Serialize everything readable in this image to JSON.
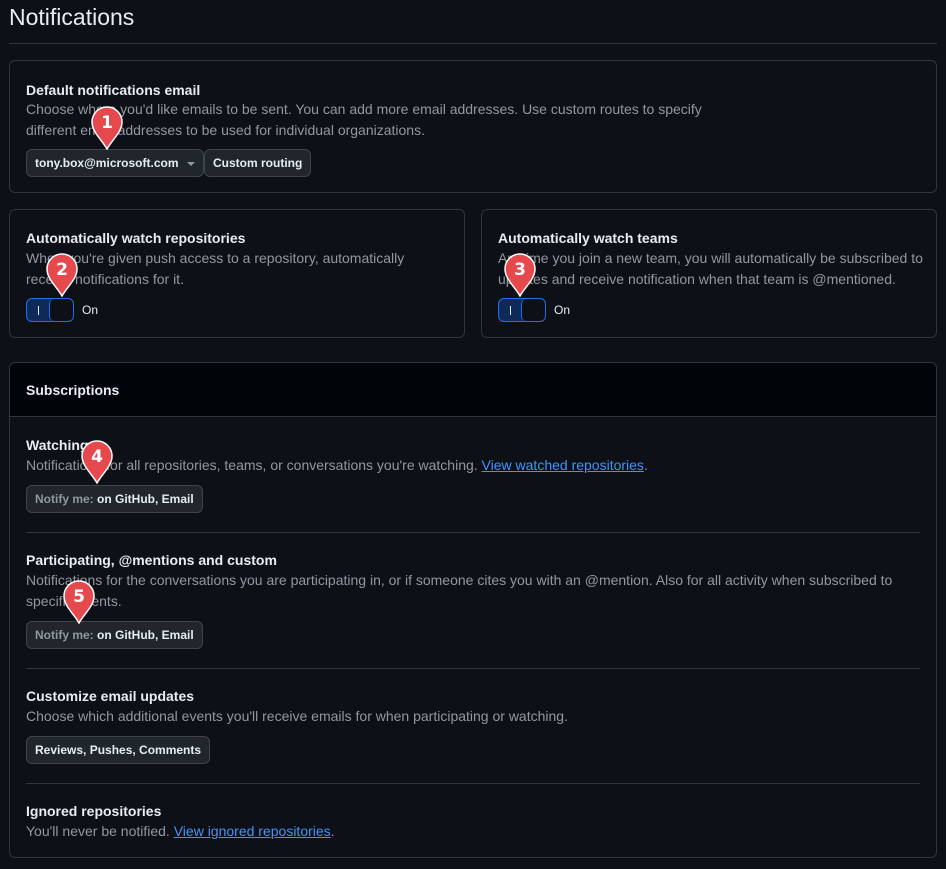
{
  "page": {
    "title": "Notifications"
  },
  "default_email": {
    "heading": "Default notifications email",
    "description": "Choose where you'd like emails to be sent. You can add more email addresses. Use custom routes to specify different email addresses to be used for individual organizations.",
    "email_select": "tony.box@microsoft.com",
    "custom_routing": "Custom routing"
  },
  "watch_repos": {
    "heading": "Automatically watch repositories",
    "description": "When you're given push access to a repository, automatically receive notifications for it.",
    "toggle_state": "On"
  },
  "watch_teams": {
    "heading": "Automatically watch teams",
    "description": "Anytime you join a new team, you will automatically be subscribed to updates and receive notification when that team is @mentioned.",
    "toggle_state": "On"
  },
  "subscriptions": {
    "heading": "Subscriptions",
    "watching": {
      "heading": "Watching",
      "description": "Notifications for all repositories, teams, or conversations you're watching.",
      "link": "View watched repositories",
      "notify_prefix": "Notify me:",
      "notify_value": "on GitHub, Email"
    },
    "participating": {
      "heading": "Participating, @mentions and custom",
      "description": "Notifications for the conversations you are participating in, or if someone cites you with an @mention. Also for all activity when subscribed to specific events.",
      "notify_prefix": "Notify me:",
      "notify_value": "on GitHub, Email"
    },
    "email_updates": {
      "heading": "Customize email updates",
      "description": "Choose which additional events you'll receive emails for when participating or watching.",
      "button": "Reviews, Pushes, Comments"
    },
    "ignored": {
      "heading": "Ignored repositories",
      "description": "You'll never be notified.",
      "link": "View ignored repositories"
    }
  },
  "markers": [
    "1",
    "2",
    "3",
    "4",
    "5"
  ],
  "colors": {
    "accent": "#1f6feb",
    "link": "#4493f8",
    "marker": "#e5484d",
    "background": "#0d1117"
  }
}
